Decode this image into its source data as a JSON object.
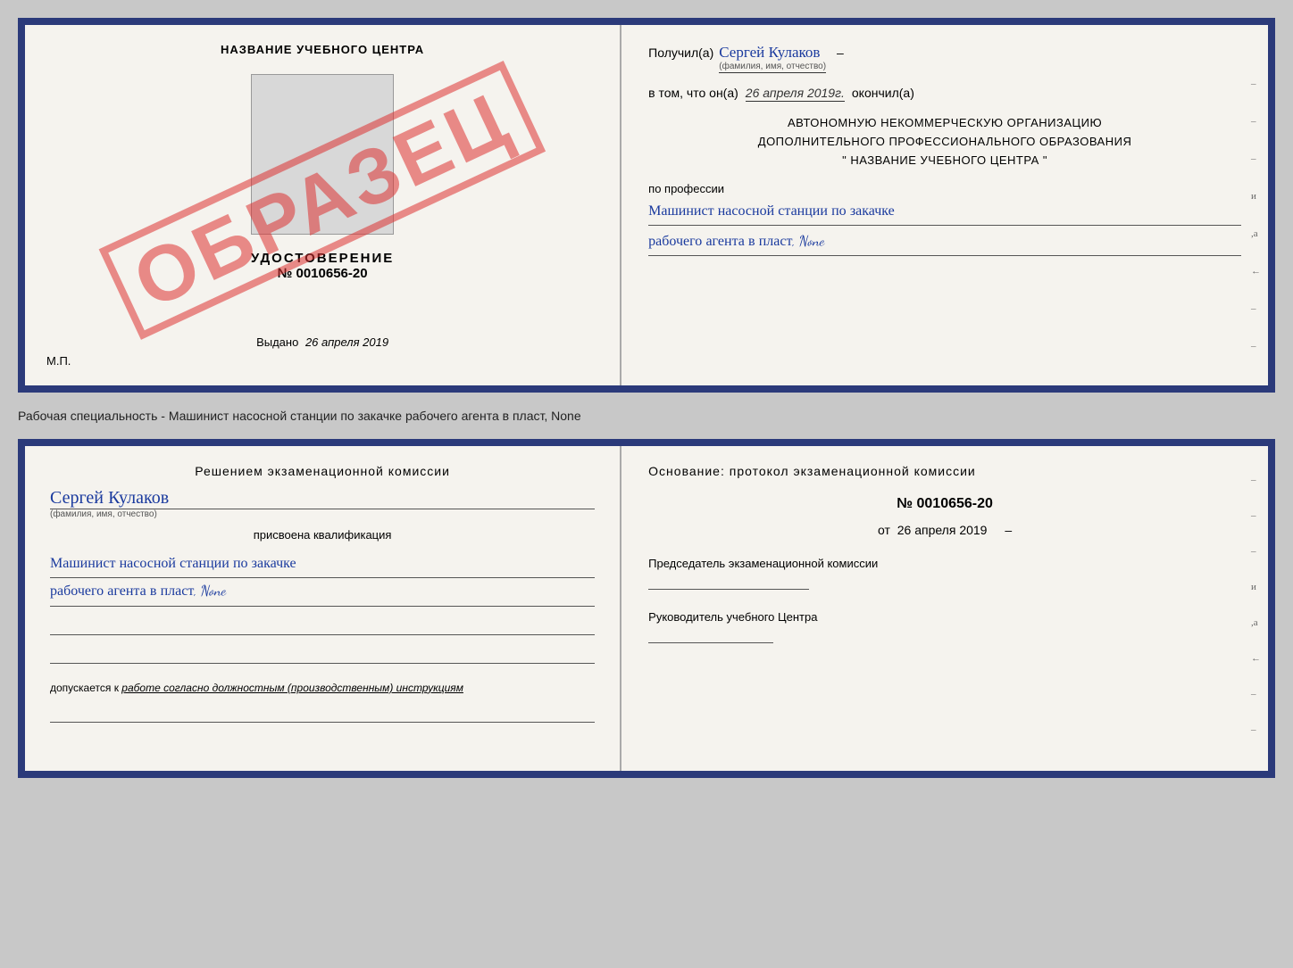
{
  "top_doc": {
    "left": {
      "center_title": "НАЗВАНИЕ УЧЕБНОГО ЦЕНТРА",
      "cert_label": "УДОСТОВЕРЕНИЕ",
      "cert_number": "№ 0010656-20",
      "issued_prefix": "Выдано",
      "issued_date": "26 апреля 2019",
      "mp_label": "М.П.",
      "obrazec": "ОБРАЗЕЦ"
    },
    "right": {
      "received_prefix": "Получил(а)",
      "received_name": "Сергей Кулаков",
      "name_sublabel": "(фамилия, имя, отчество)",
      "date_prefix": "в том, что он(а)",
      "date_value": "26 апреля 2019г.",
      "date_suffix": "окончил(а)",
      "org_line1": "АВТОНОМНУЮ НЕКОММЕРЧЕСКУЮ ОРГАНИЗАЦИЮ",
      "org_line2": "ДОПОЛНИТЕЛЬНОГО ПРОФЕССИОНАЛЬНОГО ОБРАЗОВАНИЯ",
      "org_line3": "\" НАЗВАНИЕ УЧЕБНОГО ЦЕНТРА \"",
      "profession_prefix": "по профессии",
      "profession_hw1": "Машинист насосной станции по закачке",
      "profession_hw2": "рабочего агента в пласт, None",
      "margin_marks": [
        "-",
        "-",
        "-",
        "и",
        ",а",
        "←",
        "-",
        "-"
      ]
    }
  },
  "separator": {
    "text": "Рабочая специальность - Машинист насосной станции по закачке рабочего агента в пласт, None"
  },
  "bottom_doc": {
    "left": {
      "komissia_title": "Решением экзаменационной комиссии",
      "komissia_name": "Сергей Кулаков",
      "name_sublabel": "(фамилия, имя, отчество)",
      "assigned_label": "присвоена квалификация",
      "qualification_hw1": "Машинист насосной станции по закачке",
      "qualification_hw2": "рабочего агента в пласт, None",
      "допускается_prefix": "допускается к",
      "допускается_text": "работе согласно должностным (производственным) инструкциям"
    },
    "right": {
      "osnov_title": "Основание: протокол экзаменационной комиссии",
      "protocol_number": "№ 0010656-20",
      "protocol_date_prefix": "от",
      "protocol_date": "26 апреля 2019",
      "chairman_title": "Председатель экзаменационной комиссии",
      "leader_title": "Руководитель учебного Центра",
      "margin_marks": [
        "-",
        "-",
        "-",
        "и",
        ",а",
        "←",
        "-",
        "-"
      ]
    }
  }
}
